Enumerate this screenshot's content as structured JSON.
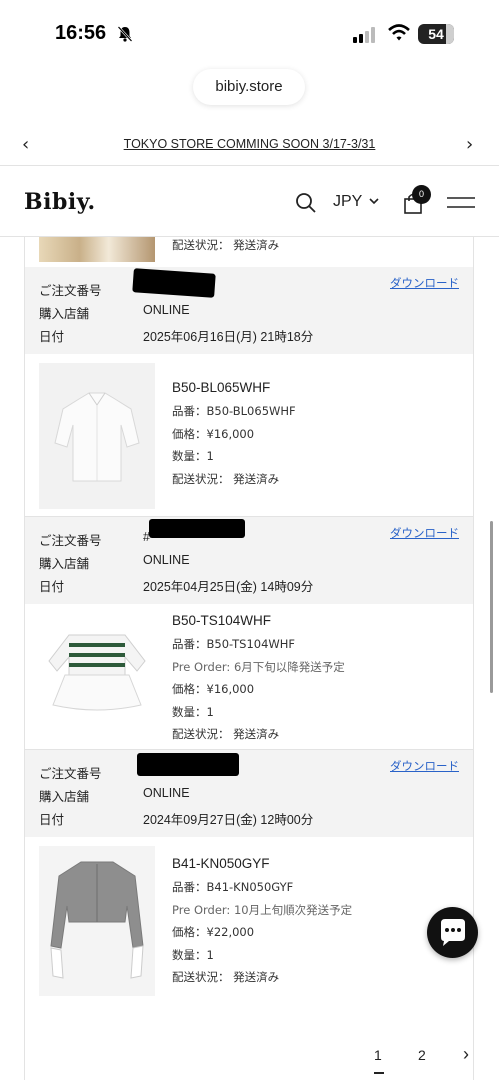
{
  "status_bar": {
    "time": "16:56",
    "battery": "54"
  },
  "browser": {
    "url": "bibiy.store"
  },
  "announcement": {
    "prev": "‹",
    "text": "TOKYO STORE COMMING SOON 3/17-3/31",
    "next": "›"
  },
  "header": {
    "logo": "Bibiy.",
    "currency": "JPY",
    "cart_count": "0"
  },
  "labels": {
    "order_number": "ご注文番号",
    "store": "購入店舗",
    "date": "日付",
    "download": "ダウンロード"
  },
  "previous_item": {
    "status": "配送状況： 発送済み"
  },
  "orders": [
    {
      "order_prefix": "#",
      "store": "ONLINE",
      "date": "2025年06月16日(月) 21時18分",
      "item": {
        "name": "B50-BL065WHF",
        "sku": "品番：B50-BL065WHF",
        "price": "価格：¥16,000",
        "qty": "数量：1",
        "status": "配送状況： 発送済み"
      }
    },
    {
      "order_prefix": "#",
      "store": "ONLINE",
      "date": "2025年04月25日(金) 14時09分",
      "item": {
        "name": "B50-TS104WHF",
        "sku": "品番：B50-TS104WHF",
        "preorder": "Pre Order: 6月下旬以降発送予定",
        "price": "価格：¥16,000",
        "qty": "数量：1",
        "status": "配送状況： 発送済み"
      }
    },
    {
      "order_prefix": "",
      "store": "ONLINE",
      "date": "2024年09月27日(金) 12時00分",
      "item": {
        "name": "B41-KN050GYF",
        "sku": "品番：B41-KN050GYF",
        "preorder": "Pre Order: 10月上旬順次発送予定",
        "price": "価格：¥22,000",
        "qty": "数量：1",
        "status": "配送状況： 発送済み"
      }
    }
  ],
  "pagination": {
    "pages": [
      "1",
      "2"
    ],
    "current": "1",
    "next": "›"
  },
  "colors": {
    "link": "#2962c8",
    "order_head_bg": "#f3f3f3",
    "chat_button": "#111111"
  }
}
